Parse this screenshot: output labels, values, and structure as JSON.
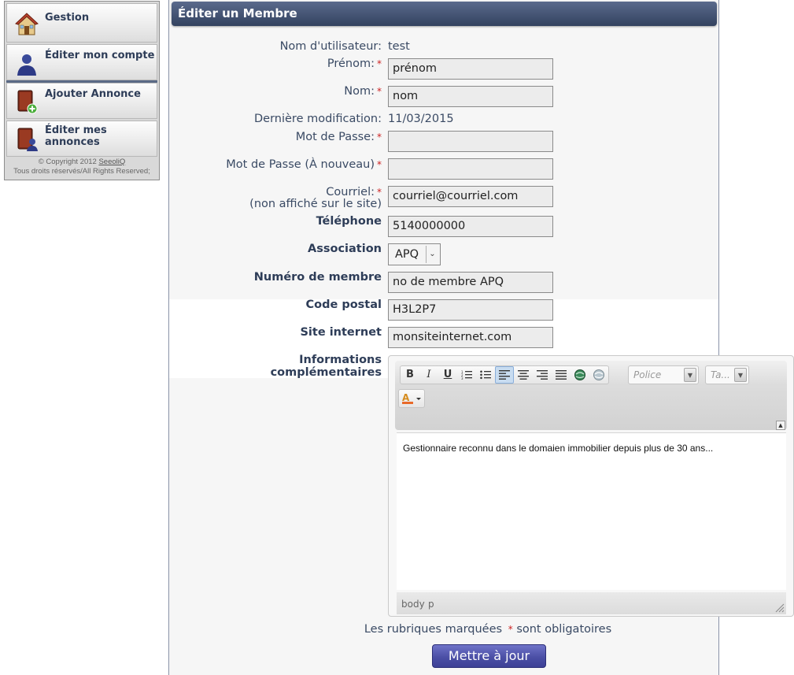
{
  "sidebar": {
    "items": [
      {
        "label": "Gestion",
        "icon": "house-icon"
      },
      {
        "label": "Éditer mon compte",
        "icon": "user-icon"
      },
      {
        "label": "Ajouter Annonce",
        "icon": "add-book-icon"
      },
      {
        "label": "Éditer mes annonces",
        "icon": "edit-book-icon"
      }
    ],
    "copyright_prefix": "© Copyright 2012",
    "copyright_brand": "SeeoliQ",
    "rights": "Tous droits réservés/All Rights Reserved;"
  },
  "form": {
    "title": "Éditer un Membre",
    "username_label": "Nom d'utilisateur:",
    "username_value": "test",
    "prenom_label": "Prénom:",
    "prenom_value": "prénom",
    "nom_label": "Nom:",
    "nom_value": "nom",
    "modified_label": "Dernière modification:",
    "modified_value": "11/03/2015",
    "password_label": "Mot de Passe:",
    "password_value": "",
    "password2_label": "Mot de Passe (À nouveau)",
    "password2_value": "",
    "email_label": "Courriel:",
    "email_sublabel": "(non affiché sur le site)",
    "email_value": "courriel@courriel.com",
    "phone_label": "Téléphone",
    "phone_value": "5140000000",
    "association_label": "Association",
    "association_value": "APQ",
    "member_number_label": "Numéro de membre",
    "member_number_value": "no de membre APQ",
    "postal_label": "Code postal",
    "postal_value": "H3L2P7",
    "website_label": "Site internet",
    "website_value": "monsiteinternet.com",
    "info_label_line1": "Informations",
    "info_label_line2": "complémentaires",
    "required_mark": "*",
    "note_prefix": "Les rubriques marquées",
    "note_suffix": "sont obligatoires",
    "submit_label": "Mettre à jour"
  },
  "editor": {
    "toolbar": {
      "bold": "B",
      "italic": "I",
      "underline": "U",
      "font_placeholder": "Police",
      "size_placeholder": "Ta..."
    },
    "content": "Gestionnaire reconnu dans le domaien immobilier depuis plus de 30 ans...",
    "status_path": [
      "body",
      "p"
    ]
  },
  "colors": {
    "title_bar": "#3b4a68",
    "submit_button": "#4b4fa6",
    "required": "#cc2222",
    "label_text": "#3a4a64"
  }
}
